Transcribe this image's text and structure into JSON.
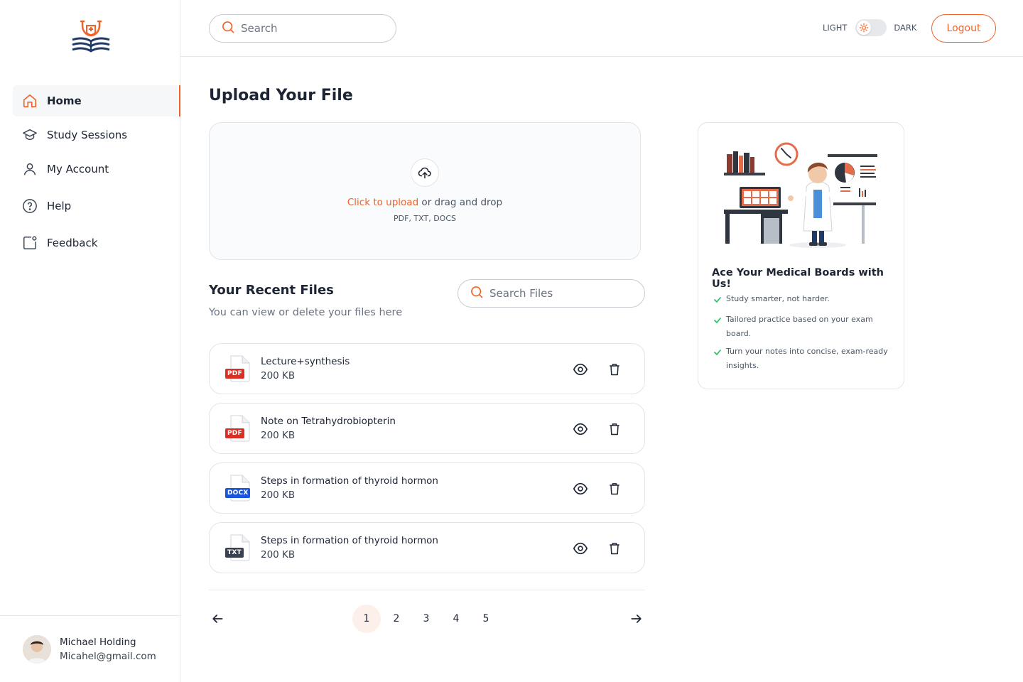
{
  "sidebar": {
    "items": [
      {
        "label": "Home",
        "icon": "home-icon",
        "active": true
      },
      {
        "label": "Study Sessions",
        "icon": "graduation-cap-icon"
      },
      {
        "label": "My Account",
        "icon": "user-icon"
      },
      {
        "label": "Help",
        "icon": "help-circle-icon"
      },
      {
        "label": "Feedback",
        "icon": "feedback-icon"
      }
    ],
    "profile": {
      "name": "Michael Holding",
      "email": "Micahel@gmail.com"
    }
  },
  "header": {
    "search_placeholder": "Search",
    "theme_light": "LIGHT",
    "theme_dark": "DARK",
    "logout_label": "Logout"
  },
  "upload": {
    "title": "Upload Your File",
    "click_label": "Click to upload",
    "drag_label": " or drag and drop",
    "types": "PDF, TXT, DOCS"
  },
  "recent": {
    "title": "Your Recent Files",
    "subtitle": "You can view or delete your files here",
    "search_placeholder": "Search Files",
    "files": [
      {
        "name": "Lecture+synthesis",
        "size": "200 KB",
        "type": "PDF"
      },
      {
        "name": "Note on Tetrahydrobiopterin",
        "size": "200 KB",
        "type": "PDF"
      },
      {
        "name": "Steps in formation of thyroid hormon",
        "size": "200 KB",
        "type": "DOCX"
      },
      {
        "name": "Steps in formation of thyroid hormon",
        "size": "200 KB",
        "type": "TXT"
      }
    ]
  },
  "pagination": {
    "pages": [
      "1",
      "2",
      "3",
      "4",
      "5"
    ],
    "current": "1"
  },
  "promo": {
    "title": "Ace Your Medical Boards with Us!",
    "points": [
      "Study smarter, not harder.",
      "Tailored practice based on your exam board.",
      "Turn your notes into concise, exam-ready insights."
    ]
  },
  "colors": {
    "accent": "#f0622a",
    "navy": "#1f3a68",
    "check": "#22c55e",
    "pdf": "#d93025",
    "docx": "#1a56db",
    "txt": "#374151"
  }
}
